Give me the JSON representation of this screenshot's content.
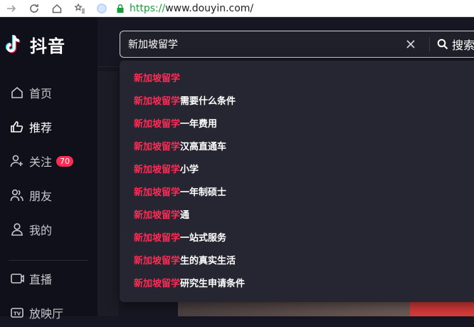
{
  "browser": {
    "url_scheme": "https://",
    "url_host": "www.douyin.com/"
  },
  "app": {
    "logo_text": "抖音"
  },
  "sidebar": {
    "items": [
      {
        "label": "首页",
        "icon": "home-icon"
      },
      {
        "label": "推荐",
        "icon": "thumbs-up-icon"
      },
      {
        "label": "关注",
        "icon": "follow-icon",
        "badge": "70"
      },
      {
        "label": "朋友",
        "icon": "friends-icon"
      },
      {
        "label": "我的",
        "icon": "user-icon"
      },
      {
        "label": "直播",
        "icon": "live-icon"
      },
      {
        "label": "放映厅",
        "icon": "tv-icon"
      }
    ]
  },
  "search": {
    "value": "新加坡留学",
    "button_label": "搜索"
  },
  "suggestions": [
    {
      "highlight": "新加坡留学",
      "rest": ""
    },
    {
      "highlight": "新加坡留学",
      "rest": "需要什么条件"
    },
    {
      "highlight": "新加坡留学",
      "rest": "一年费用"
    },
    {
      "highlight": "新加坡留学",
      "rest": "汉高直通车"
    },
    {
      "highlight": "新加坡留学",
      "rest": "小学"
    },
    {
      "highlight": "新加坡留学",
      "rest": "一年制硕士"
    },
    {
      "highlight": "新加坡留学",
      "rest": "通"
    },
    {
      "highlight": "新加坡留学",
      "rest": "一站式服务"
    },
    {
      "highlight": "新加坡留学",
      "rest": "生的真实生活"
    },
    {
      "highlight": "新加坡留学",
      "rest": "研究生申请条件"
    }
  ],
  "colors": {
    "accent": "#fe2c55",
    "background": "#161722",
    "sidebar": "#0f101a",
    "dropdown": "#252632"
  }
}
